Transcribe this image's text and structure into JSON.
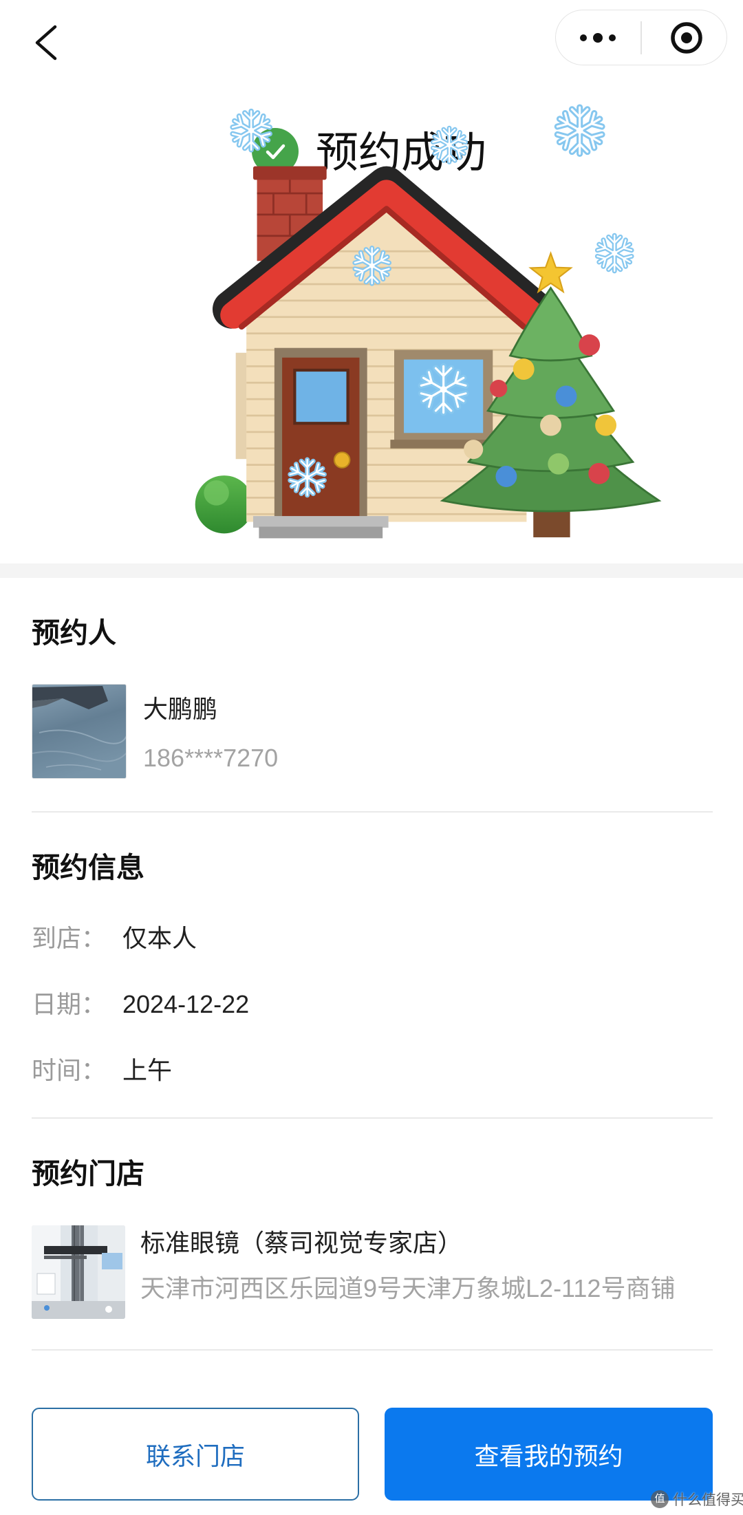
{
  "nav": {
    "back_icon": "chevron-left-icon",
    "more_icon": "more-dots-icon",
    "target_icon": "target-circle-icon"
  },
  "status": {
    "icon": "check-circle-icon",
    "title": "预约成功"
  },
  "decorations": {
    "icons": [
      "house-icon",
      "christmas-tree-icon",
      "snowflake-icon",
      "bush-icon",
      "star-icon"
    ]
  },
  "booker": {
    "section_title": "预约人",
    "avatar_icon": "user-avatar-photo",
    "name": "大鹏鹏",
    "phone": "186****7270"
  },
  "info": {
    "section_title": "预约信息",
    "rows": [
      {
        "label": "到店：",
        "value": "仅本人"
      },
      {
        "label": "日期：",
        "value": "2024-12-22"
      },
      {
        "label": "时间：",
        "value": "上午"
      }
    ]
  },
  "store": {
    "section_title": "预约门店",
    "photo_icon": "store-photo",
    "name": "标准眼镜（蔡司视觉专家店）",
    "address": "天津市河西区乐园道9号天津万象城L2-112号商铺"
  },
  "actions": {
    "contact_label": "联系门店",
    "view_label": "查看我的预约"
  },
  "watermark": {
    "logo_char": "值",
    "text": "什么值得买"
  },
  "colors": {
    "success_green": "#45a44a",
    "primary_blue": "#0b79ee",
    "outline_border": "#2b6fa5",
    "outline_text": "#1f6dbf",
    "muted_text": "#a3a3a3",
    "divider": "#e9e9e9"
  }
}
